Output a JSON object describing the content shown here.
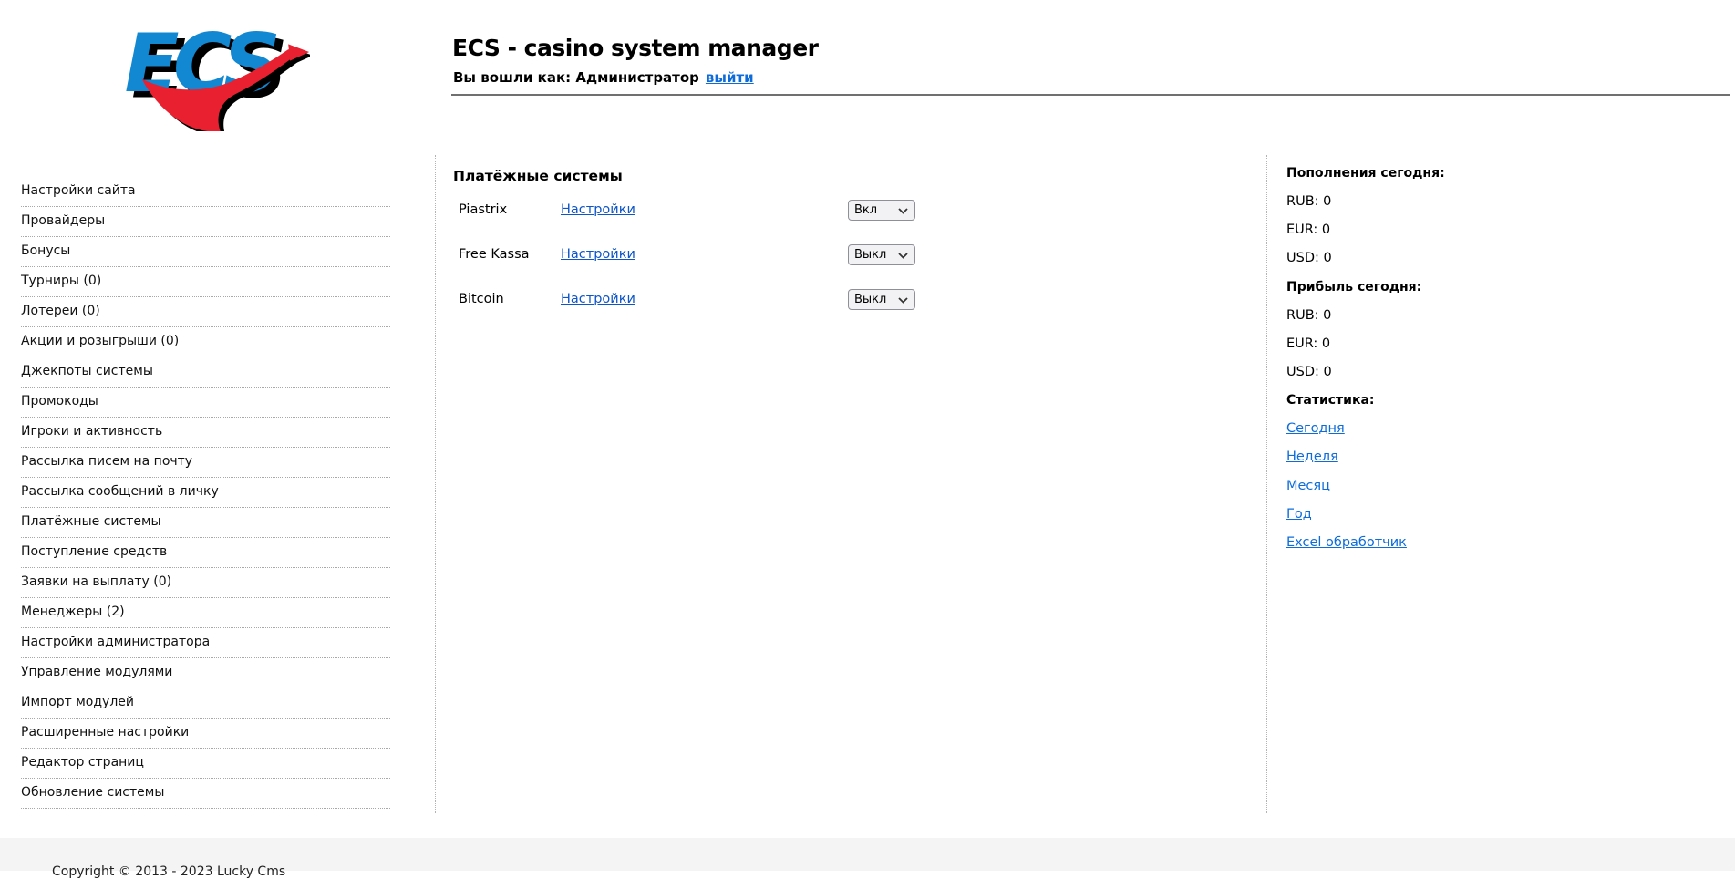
{
  "logo": {
    "text": "ECS"
  },
  "header": {
    "title": "ECS - casino system manager",
    "login_prefix": "Вы вошли как: Администратор",
    "logout_label": "выйти"
  },
  "sidebar": {
    "items": [
      "Настройки сайта",
      "Провайдеры",
      "Бонусы",
      "Турниры (0)",
      "Лотереи (0)",
      "Акции и розыгрыши (0)",
      "Джекпоты системы",
      "Промокоды",
      "Игроки и активность",
      "Рассылка писем на почту",
      "Рассылка сообщений в личку",
      "Платёжные системы",
      "Поступление средств",
      "Заявки на выплату (0)",
      "Менеджеры (2)",
      "Настройки администратора",
      "Управление модулями",
      "Импорт модулей",
      "Расширенные настройки",
      "Редактор страниц",
      "Обновление системы"
    ]
  },
  "main": {
    "heading": "Платёжные системы",
    "rows": [
      {
        "name": "Piastrix",
        "settings_label": "Настройки",
        "state": "Вкл"
      },
      {
        "name": "Free Kassa",
        "settings_label": "Настройки",
        "state": "Выкл"
      },
      {
        "name": "Bitcoin",
        "settings_label": "Настройки",
        "state": "Выкл"
      }
    ]
  },
  "stats": {
    "deposits_heading": "Пополнения сегодня:",
    "deposits": [
      "RUB: 0",
      "EUR: 0",
      "USD: 0"
    ],
    "profit_heading": "Прибыль сегодня:",
    "profit": [
      "RUB: 0",
      "EUR: 0",
      "USD: 0"
    ],
    "stats_heading": "Статистика:",
    "links": [
      "Сегодня",
      "Неделя",
      "Месяц",
      "Год",
      "Excel обработчик"
    ]
  },
  "footer": {
    "copyright": "Copyright © 2013 - 2023 Lucky Cms"
  },
  "colors": {
    "logo_blue": "#1287d2",
    "logo_red": "#e8202f",
    "link_blue": "#0d6cda",
    "header_rule": "#707070",
    "footer_bg": "#f4f4f4"
  }
}
